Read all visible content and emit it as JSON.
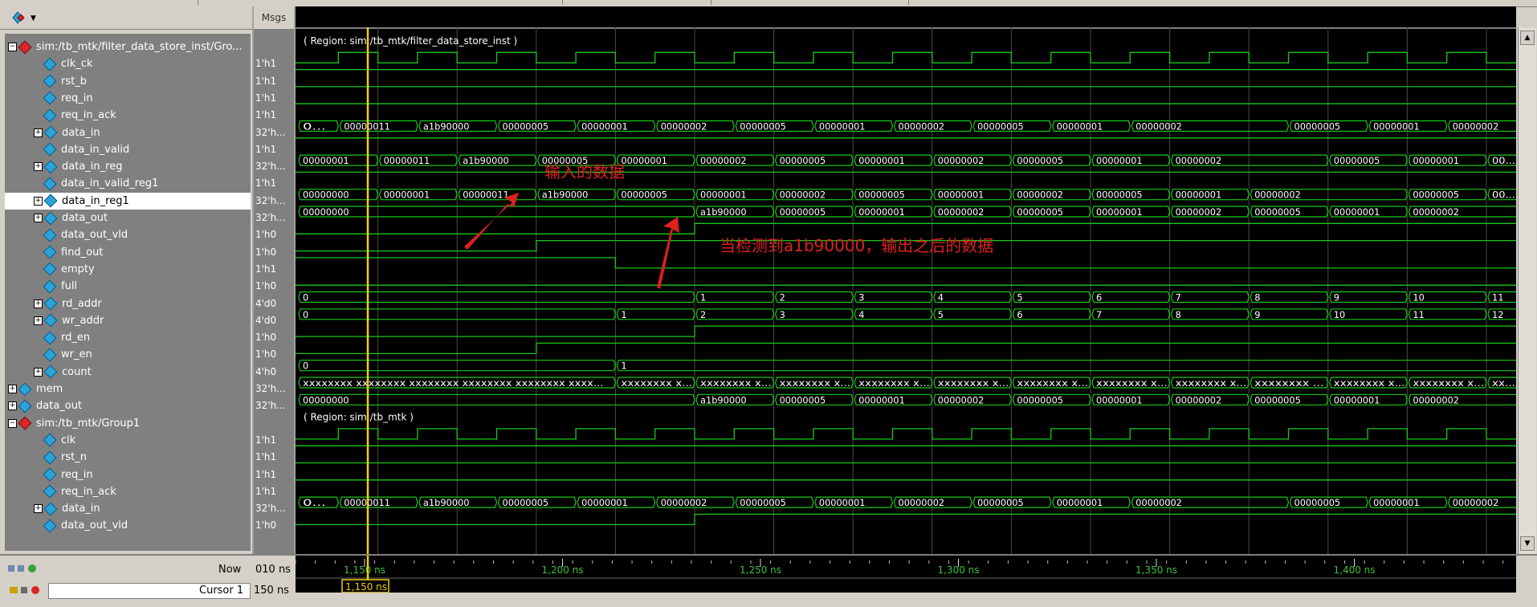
{
  "header": {
    "msgs_label": "Msgs"
  },
  "signals": [
    {
      "name": "sim:/tb_mtk/filter_data_store_inst/Gro...",
      "value": "",
      "type": "group",
      "level": 0
    },
    {
      "name": "clk_ck",
      "value": "1'h1",
      "type": "in",
      "level": 1
    },
    {
      "name": "rst_b",
      "value": "1'h1",
      "type": "in",
      "level": 1
    },
    {
      "name": "req_in",
      "value": "1'h1",
      "type": "in",
      "level": 1
    },
    {
      "name": "req_in_ack",
      "value": "1'h1",
      "type": "out",
      "level": 1
    },
    {
      "name": "data_in",
      "value": "32'h...",
      "type": "in-bus",
      "level": 1
    },
    {
      "name": "data_in_valid",
      "value": "1'h1",
      "type": "sig",
      "level": 1
    },
    {
      "name": "data_in_reg",
      "value": "32'h...",
      "type": "bus",
      "level": 1
    },
    {
      "name": "data_in_valid_reg1",
      "value": "1'h1",
      "type": "sig",
      "level": 1
    },
    {
      "name": "data_in_reg1",
      "value": "32'h...",
      "type": "bus",
      "level": 1,
      "selected": true
    },
    {
      "name": "data_out",
      "value": "32'h...",
      "type": "out-bus",
      "level": 1
    },
    {
      "name": "data_out_vld",
      "value": "1'h0",
      "type": "out",
      "level": 1
    },
    {
      "name": "find_out",
      "value": "1'h0",
      "type": "sig",
      "level": 1
    },
    {
      "name": "empty",
      "value": "1'h1",
      "type": "sig",
      "level": 1
    },
    {
      "name": "full",
      "value": "1'h0",
      "type": "sig",
      "level": 1
    },
    {
      "name": "rd_addr",
      "value": "4'd0",
      "type": "bus",
      "level": 1
    },
    {
      "name": "wr_addr",
      "value": "4'd0",
      "type": "bus",
      "level": 1
    },
    {
      "name": "rd_en",
      "value": "1'h0",
      "type": "sig",
      "level": 1
    },
    {
      "name": "wr_en",
      "value": "1'h0",
      "type": "sig",
      "level": 1
    },
    {
      "name": "count",
      "value": "4'h0",
      "type": "bus",
      "level": 1
    },
    {
      "name": "mem",
      "value": "32'h...",
      "type": "bus",
      "level": 0
    },
    {
      "name": "data_out",
      "value": "32'h...",
      "type": "bus",
      "level": 0
    },
    {
      "name": "sim:/tb_mtk/Group1",
      "value": "",
      "type": "group",
      "level": 0
    },
    {
      "name": "clk",
      "value": "1'h1",
      "type": "sig",
      "level": 1
    },
    {
      "name": "rst_n",
      "value": "1'h1",
      "type": "sig",
      "level": 1
    },
    {
      "name": "req_in",
      "value": "1'h1",
      "type": "sig",
      "level": 1
    },
    {
      "name": "req_in_ack",
      "value": "1'h1",
      "type": "sig",
      "level": 1
    },
    {
      "name": "data_in",
      "value": "32'h...",
      "type": "bus",
      "level": 1
    },
    {
      "name": "data_out_vld",
      "value": "1'h0",
      "type": "sig",
      "level": 1
    }
  ],
  "regions": {
    "r1": "( Region: sim:/tb_mtk/filter_data_store_inst )",
    "r2": "( Region: sim:/tb_mtk )"
  },
  "buses": {
    "data_in": [
      {
        "t": 0,
        "v": "0..."
      },
      {
        "t": 1,
        "v": "00000011"
      },
      {
        "t": 3,
        "v": "a1b90000"
      },
      {
        "t": 5,
        "v": "00000005"
      },
      {
        "t": 7,
        "v": "00000001"
      },
      {
        "t": 9,
        "v": "00000002"
      },
      {
        "t": 11,
        "v": "00000005"
      },
      {
        "t": 13,
        "v": "00000001"
      },
      {
        "t": 15,
        "v": "00000002"
      },
      {
        "t": 17,
        "v": "00000005"
      },
      {
        "t": 19,
        "v": "00000001"
      },
      {
        "t": 21,
        "v": "00000002"
      },
      {
        "t": 25,
        "v": "00000005"
      },
      {
        "t": 27,
        "v": "00000001"
      },
      {
        "t": 29,
        "v": "00000002"
      }
    ],
    "data_in_reg": [
      {
        "t": 0,
        "v": "00000001"
      },
      {
        "t": 2,
        "v": "00000011"
      },
      {
        "t": 4,
        "v": "a1b90000"
      },
      {
        "t": 6,
        "v": "00000005"
      },
      {
        "t": 8,
        "v": "00000001"
      },
      {
        "t": 10,
        "v": "00000002"
      },
      {
        "t": 12,
        "v": "00000005"
      },
      {
        "t": 14,
        "v": "00000001"
      },
      {
        "t": 16,
        "v": "00000002"
      },
      {
        "t": 18,
        "v": "00000005"
      },
      {
        "t": 20,
        "v": "00000001"
      },
      {
        "t": 22,
        "v": "00000002"
      },
      {
        "t": 26,
        "v": "00000005"
      },
      {
        "t": 28,
        "v": "00000001"
      },
      {
        "t": 30,
        "v": "00..."
      }
    ],
    "data_in_reg1": [
      {
        "t": 0,
        "v": "00000000"
      },
      {
        "t": 2,
        "v": "00000001"
      },
      {
        "t": 4,
        "v": "00000011"
      },
      {
        "t": 6,
        "v": "a1b90000"
      },
      {
        "t": 8,
        "v": "00000005"
      },
      {
        "t": 10,
        "v": "00000001"
      },
      {
        "t": 12,
        "v": "00000002"
      },
      {
        "t": 14,
        "v": "00000005"
      },
      {
        "t": 16,
        "v": "00000001"
      },
      {
        "t": 18,
        "v": "00000002"
      },
      {
        "t": 20,
        "v": "00000005"
      },
      {
        "t": 22,
        "v": "00000001"
      },
      {
        "t": 24,
        "v": "00000002"
      },
      {
        "t": 28,
        "v": "00000005"
      },
      {
        "t": 30,
        "v": "00..."
      }
    ],
    "data_out": [
      {
        "t": 0,
        "v": "00000000"
      },
      {
        "t": 10,
        "v": "a1b90000"
      },
      {
        "t": 12,
        "v": "00000005"
      },
      {
        "t": 14,
        "v": "00000001"
      },
      {
        "t": 16,
        "v": "00000002"
      },
      {
        "t": 18,
        "v": "00000005"
      },
      {
        "t": 20,
        "v": "00000001"
      },
      {
        "t": 22,
        "v": "00000002"
      },
      {
        "t": 24,
        "v": "00000005"
      },
      {
        "t": 26,
        "v": "00000001"
      },
      {
        "t": 28,
        "v": "00000002"
      }
    ],
    "rd_addr": [
      {
        "t": 0,
        "v": "0"
      },
      {
        "t": 10,
        "v": "1"
      },
      {
        "t": 12,
        "v": "2"
      },
      {
        "t": 14,
        "v": "3"
      },
      {
        "t": 16,
        "v": "4"
      },
      {
        "t": 18,
        "v": "5"
      },
      {
        "t": 20,
        "v": "6"
      },
      {
        "t": 22,
        "v": "7"
      },
      {
        "t": 24,
        "v": "8"
      },
      {
        "t": 26,
        "v": "9"
      },
      {
        "t": 28,
        "v": "10"
      },
      {
        "t": 30,
        "v": "11"
      }
    ],
    "wr_addr": [
      {
        "t": 0,
        "v": "0"
      },
      {
        "t": 8,
        "v": "1"
      },
      {
        "t": 10,
        "v": "2"
      },
      {
        "t": 12,
        "v": "3"
      },
      {
        "t": 14,
        "v": "4"
      },
      {
        "t": 16,
        "v": "5"
      },
      {
        "t": 18,
        "v": "6"
      },
      {
        "t": 20,
        "v": "7"
      },
      {
        "t": 22,
        "v": "8"
      },
      {
        "t": 24,
        "v": "9"
      },
      {
        "t": 26,
        "v": "10"
      },
      {
        "t": 28,
        "v": "11"
      },
      {
        "t": 30,
        "v": "12"
      }
    ],
    "count": [
      {
        "t": 0,
        "v": "0"
      },
      {
        "t": 8,
        "v": "1"
      }
    ],
    "mem": [
      {
        "t": 0,
        "v": "xxxxxxxx xxxxxxxx xxxxxxxx xxxxxxxx xxxxxxxx xxxx..."
      },
      {
        "t": 8,
        "v": "xxxxxxxx x..."
      },
      {
        "t": 10,
        "v": "xxxxxxxx x..."
      },
      {
        "t": 12,
        "v": "xxxxxxxx x..."
      },
      {
        "t": 14,
        "v": "xxxxxxxx x..."
      },
      {
        "t": 16,
        "v": "xxxxxxxx x..."
      },
      {
        "t": 18,
        "v": "xxxxxxxx x..."
      },
      {
        "t": 20,
        "v": "xxxxxxxx x..."
      },
      {
        "t": 22,
        "v": "xxxxxxxx x..."
      },
      {
        "t": 24,
        "v": "xxxxxxxx ..."
      },
      {
        "t": 26,
        "v": "xxxxxxxx x..."
      },
      {
        "t": 28,
        "v": "xxxxxxxx x..."
      },
      {
        "t": 30,
        "v": "xx..."
      }
    ],
    "data_out2": [
      {
        "t": 0,
        "v": "00000000"
      },
      {
        "t": 10,
        "v": "a1b90000"
      },
      {
        "t": 12,
        "v": "00000005"
      },
      {
        "t": 14,
        "v": "00000001"
      },
      {
        "t": 16,
        "v": "00000002"
      },
      {
        "t": 18,
        "v": "00000005"
      },
      {
        "t": 20,
        "v": "00000001"
      },
      {
        "t": 22,
        "v": "00000002"
      },
      {
        "t": 24,
        "v": "00000005"
      },
      {
        "t": 26,
        "v": "00000001"
      },
      {
        "t": 28,
        "v": "00000002"
      }
    ],
    "data_in2": [
      {
        "t": 0,
        "v": "0..."
      },
      {
        "t": 1,
        "v": "00000011"
      },
      {
        "t": 3,
        "v": "a1b90000"
      },
      {
        "t": 5,
        "v": "00000005"
      },
      {
        "t": 7,
        "v": "00000001"
      },
      {
        "t": 9,
        "v": "00000002"
      },
      {
        "t": 11,
        "v": "00000005"
      },
      {
        "t": 13,
        "v": "00000001"
      },
      {
        "t": 15,
        "v": "00000002"
      },
      {
        "t": 17,
        "v": "00000005"
      },
      {
        "t": 19,
        "v": "00000001"
      },
      {
        "t": 21,
        "v": "00000002"
      },
      {
        "t": 25,
        "v": "00000005"
      },
      {
        "t": 27,
        "v": "00000001"
      },
      {
        "t": 29,
        "v": "00000002"
      }
    ]
  },
  "timeline": {
    "ticks": [
      "1,150 ns",
      "1,200 ns",
      "1,250 ns",
      "1,300 ns",
      "1,350 ns",
      "1,400 ns"
    ],
    "now_label": "Now",
    "now_value": "010 ns",
    "cursor_label": "Cursor 1",
    "cursor_value": "150 ns",
    "cursor_flag": "1,150 ns"
  },
  "annotations": {
    "input_note": "输入的数据",
    "output_note": "当检测到a1b90000，输出之后的数据"
  },
  "colors": {
    "wave": "#19c819",
    "cursor": "#f2d000",
    "annotation": "#e02020",
    "bus_text": "#ffffff"
  }
}
